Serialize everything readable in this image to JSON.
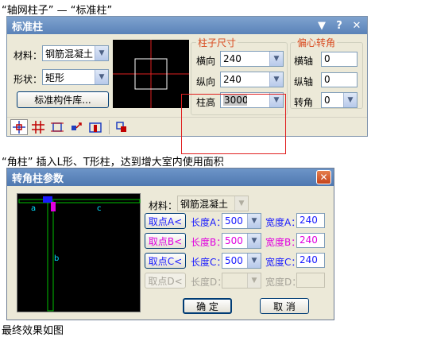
{
  "captions": {
    "top": "“轴网柱子” — “标准柱”",
    "middle": "“角柱” 插入L形、T形柱，达到增大室内使用面积",
    "bottom": "最终效果如图"
  },
  "std_window": {
    "title": "标准柱",
    "pin_glyph": "▼",
    "help_glyph": "?",
    "close_glyph": "✕",
    "material_label": "材料：",
    "material_value": "钢筋混凝土",
    "shape_label": "形状：",
    "shape_value": "矩形",
    "library_button": "标准构件库...",
    "size_group": "柱子尺寸",
    "horiz_label": "横向",
    "horiz_value": "240",
    "vert_label": "纵向",
    "vert_value": "240",
    "height_label": "柱高",
    "height_value": "3000",
    "offset_group": "偏心转角",
    "xaxis_label": "横轴",
    "xaxis_value": "0",
    "yaxis_label": "纵轴",
    "yaxis_value": "0",
    "rotate_label": "转角",
    "rotate_value": "0"
  },
  "corner_window": {
    "title": "转角柱参数",
    "close_glyph": "✕",
    "material_label": "材料：",
    "material_value": "钢筋混凝土",
    "legs": [
      {
        "pick": "取点A<",
        "len_label": "长度A：",
        "len_value": "500",
        "w_label": "宽度A：",
        "w_value": "240",
        "color": "#1a1aff"
      },
      {
        "pick": "取点B<",
        "len_label": "长度B：",
        "len_value": "500",
        "w_label": "宽度B：",
        "w_value": "240",
        "color": "#e000e0"
      },
      {
        "pick": "取点C<",
        "len_label": "长度C：",
        "len_value": "500",
        "w_label": "宽度C：",
        "w_value": "240",
        "color": "#1a1aff"
      },
      {
        "pick": "取点D<",
        "len_label": "长度D：",
        "len_value": "",
        "w_label": "宽度D：",
        "w_value": "",
        "color": "#a7a49a"
      }
    ],
    "ok_label": "确  定",
    "cancel_label": "取  消",
    "preview_labels": {
      "a": "a",
      "b": "b",
      "c": "c"
    }
  },
  "colors": {
    "title_blue": "#6d95c8",
    "group_title": "#d84a1f",
    "highlight_red": "#e02020",
    "preview_green": "#00c000",
    "preview_cyan": "#00e0ff"
  }
}
